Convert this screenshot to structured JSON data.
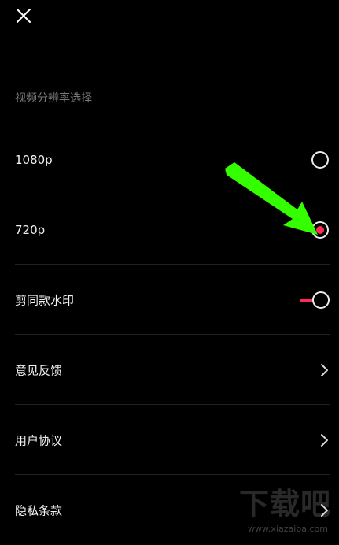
{
  "header": {
    "close_icon": "close-icon"
  },
  "resolution": {
    "section_title": "视频分辨率选择",
    "options": [
      {
        "label": "1080p",
        "selected": false
      },
      {
        "label": "720p",
        "selected": true
      }
    ]
  },
  "settings": {
    "watermark_label": "剪同款水印",
    "watermark_enabled": true,
    "feedback_label": "意见反馈",
    "user_agreement_label": "用户协议",
    "privacy_label": "隐私条款"
  },
  "site_watermark": {
    "brand": "下载吧",
    "url": "www.xiazaiba.com"
  },
  "colors": {
    "background": "#000000",
    "accent": "#fe2c55",
    "annotation_arrow": "#33ff00",
    "muted_text": "#7a7a7a"
  }
}
